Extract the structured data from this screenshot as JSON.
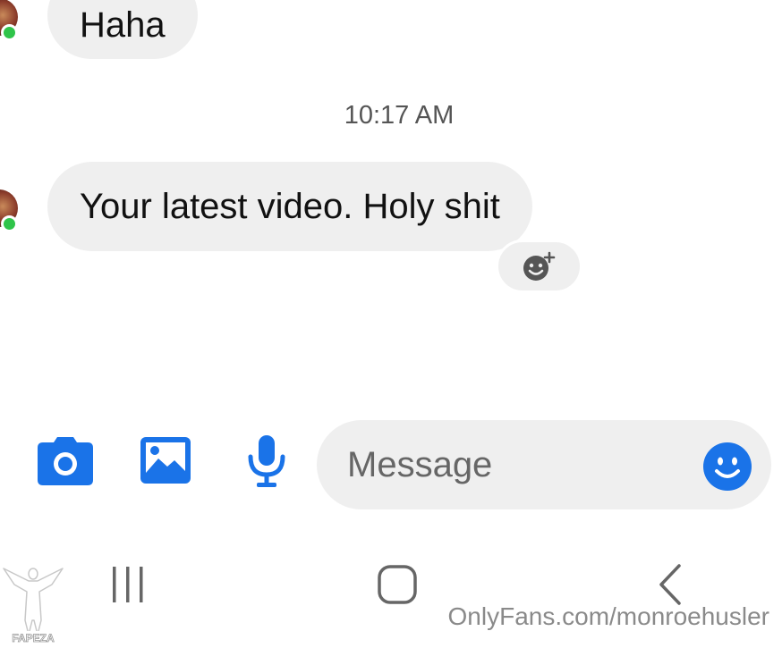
{
  "conversation": {
    "messages": [
      {
        "text": "Haha"
      },
      {
        "text": "Your latest video. Holy shit"
      }
    ],
    "timestamp": "10:17 AM"
  },
  "composer": {
    "placeholder": "Message",
    "icons": [
      "camera-icon",
      "gallery-icon",
      "microphone-icon",
      "emoji-icon"
    ]
  },
  "navigation": {
    "buttons": [
      "recent-apps",
      "home",
      "back"
    ]
  },
  "watermark": {
    "text": "OnlyFans.com/monroehusler",
    "logo_text": "FAPEZA"
  },
  "colors": {
    "accent": "#1a73e8",
    "bubble": "#efefef",
    "online": "#2fc44a"
  }
}
